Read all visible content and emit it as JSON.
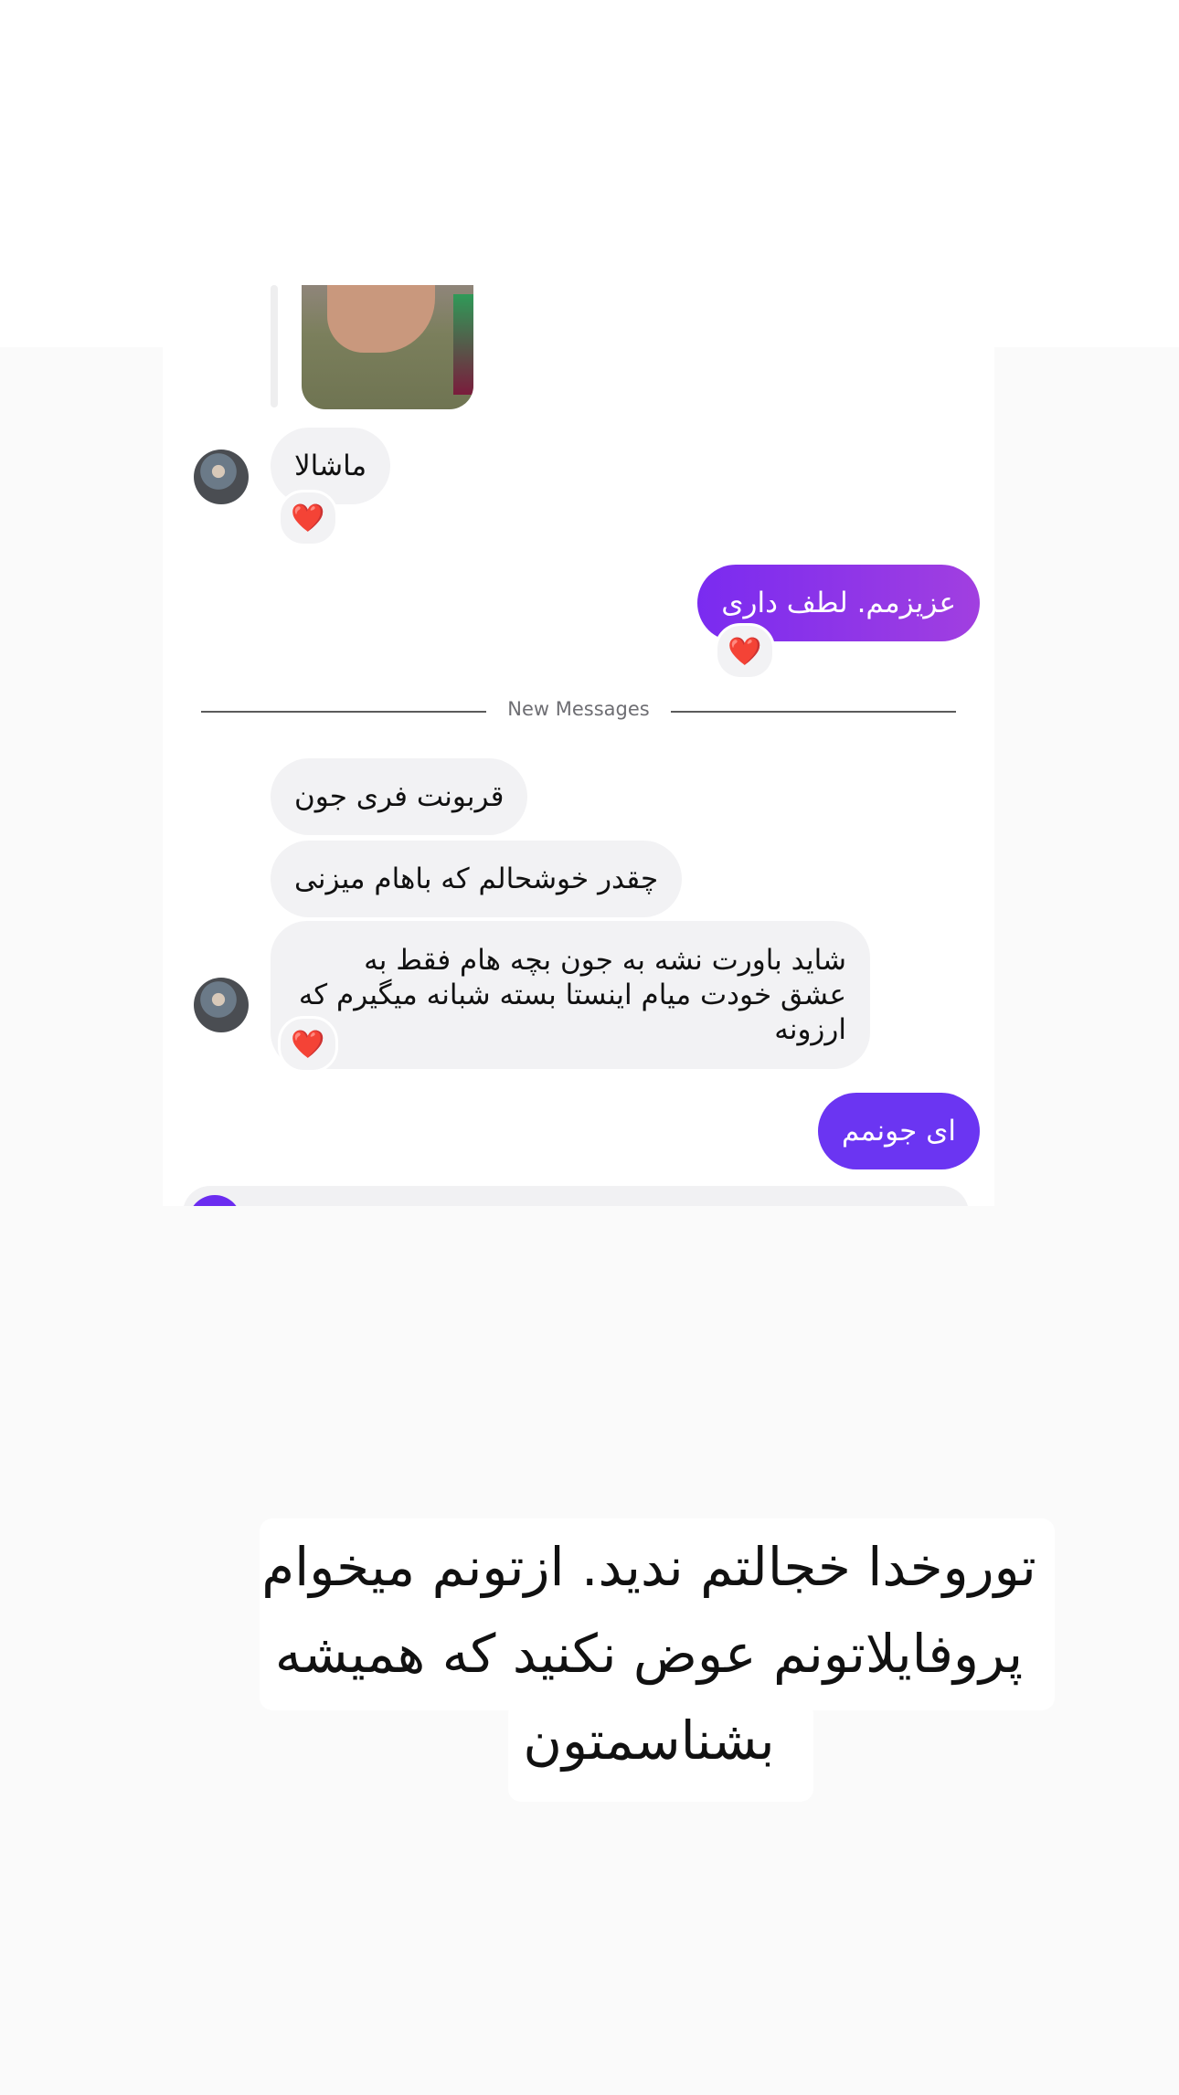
{
  "chat": {
    "messages": [
      {
        "from": "them",
        "text": "ماشالا",
        "reaction": "❤️"
      },
      {
        "from": "me",
        "text": "عزیزمم. لطف داری",
        "reaction": "❤️"
      },
      {
        "from": "them",
        "text": "قربونت فری جون"
      },
      {
        "from": "them",
        "text": "چقدر خوشحالم که باهام میزنی"
      },
      {
        "from": "them",
        "text": "شاید باورت نشه به جون بچه هام فقط به عشق خودت میام اینستا بسته شبانه میگیرم که ارزونه",
        "reaction": "❤️"
      },
      {
        "from": "me",
        "text": "ای جونمم"
      }
    ],
    "divider": "New Messages",
    "colors": {
      "out_gradient_start": "#9b3be6",
      "out_gradient_end": "#7a2bf0",
      "out_solid": "#6b35f2",
      "incoming": "#f2f2f4"
    }
  },
  "caption": {
    "text": "توروخدا خجالتم ندید. ازتونم میخوام\nپروفایلاتونم عوض نکنید که همیشه\nبشناسمتون"
  },
  "icons": {
    "reaction": "heart-icon",
    "avatar": "avatar",
    "camera": "camera-icon"
  }
}
